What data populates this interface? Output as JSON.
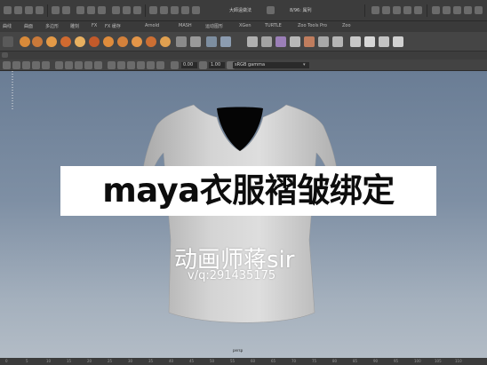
{
  "status_line": {
    "workspace_label": "大師遠做法",
    "mode_label": "8/96: 属列"
  },
  "shelf": {
    "tabs": [
      "曲线",
      "曲面",
      "多边形",
      "雕刻",
      "FX",
      "FX 缓存",
      "Arnold",
      "MASH",
      "运动图形",
      "XGen",
      "TURTLE",
      "Zoo Tools Pro",
      "Zoo"
    ]
  },
  "panel_toolbar": {
    "exposure_value": "0.00",
    "gamma_value": "1.00",
    "color_space": "sRGB gamma"
  },
  "viewport": {
    "camera_name": "persp",
    "background_top_color": "#6a7d95",
    "background_bottom_color": "#b3bcc6"
  },
  "overlay": {
    "title": "maya衣服褶皱绑定",
    "author": "动画师蒋sir",
    "contact": "v/q:291435175"
  },
  "time_slider": {
    "ticks": [
      "0",
      "5",
      "10",
      "15",
      "20",
      "25",
      "30",
      "35",
      "40",
      "45",
      "50",
      "55",
      "60",
      "65",
      "70",
      "75",
      "80",
      "85",
      "90",
      "95",
      "100",
      "105",
      "110"
    ]
  }
}
